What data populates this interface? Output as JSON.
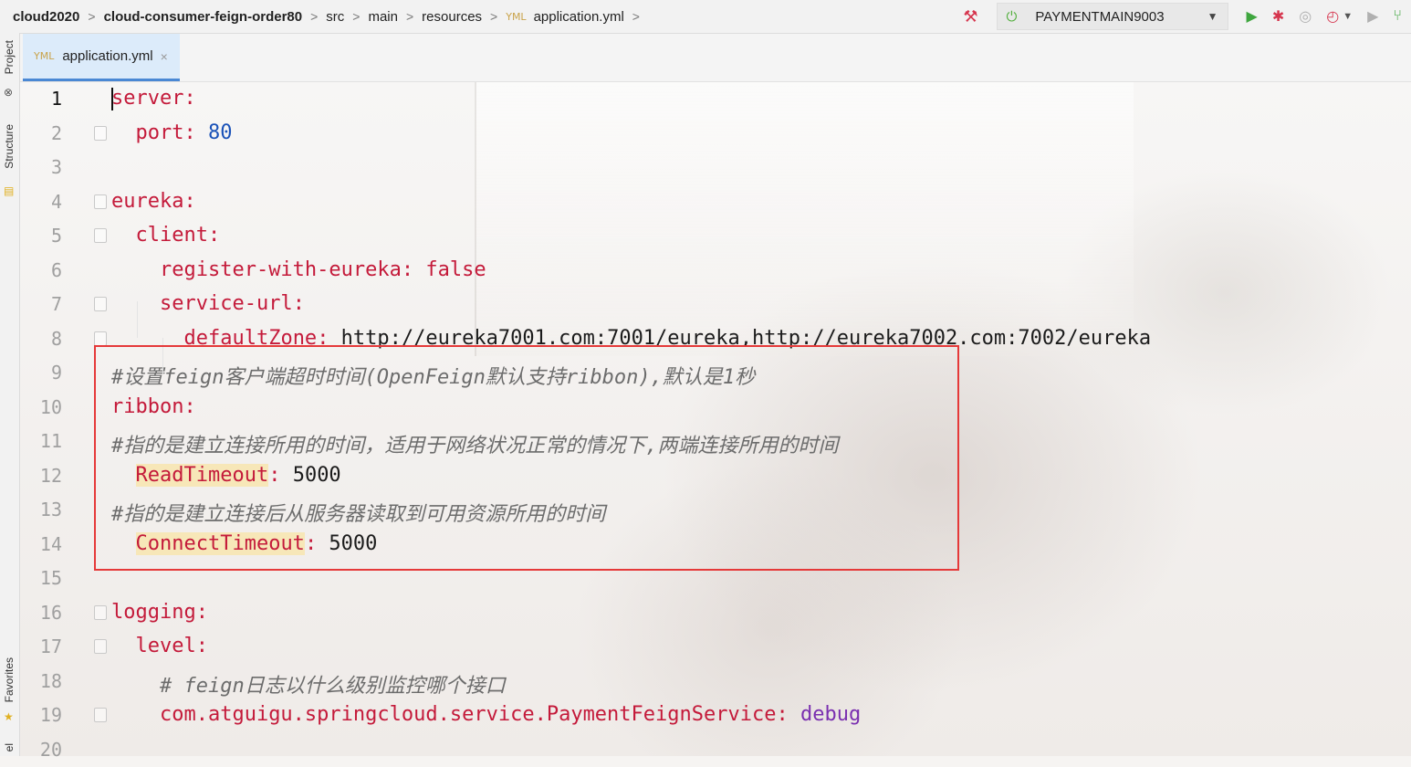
{
  "breadcrumbs": [
    "cloud2020",
    "cloud-consumer-feign-order80",
    "src",
    "main",
    "resources",
    "application.yml"
  ],
  "breadcrumb_file_icon": "YML",
  "run_config": "PAYMENTMAIN9003",
  "tab": {
    "label": "application.yml",
    "close": "×"
  },
  "left_strip": {
    "project": "Project",
    "structure": "Structure",
    "favorites": "Favorites",
    "bottom": "el"
  },
  "icons": {
    "build": "hammer-icon",
    "power": "power-icon",
    "dropdown": "chevron-down-icon",
    "run": "run-icon",
    "debug": "bug-icon",
    "coverage": "coverage-icon",
    "profiler": "profiler-icon",
    "stop": "stop-icon",
    "vcs": "git-branch-icon"
  },
  "colors": {
    "key": "#c41a3a",
    "number": "#1a52b8",
    "comment": "#6c6c6c",
    "enum": "#7a2fb0",
    "highlight": "#f7e7b8",
    "box": "#e53939",
    "tab_active": "#dcebfa"
  },
  "editor": {
    "current_line": 1,
    "lines": [
      {
        "n": "1",
        "kind": "kv",
        "indent": 0,
        "key": "server",
        "colon": ":",
        "value": "",
        "fold": false
      },
      {
        "n": "2",
        "kind": "kv",
        "indent": 1,
        "key": "port",
        "colon": ":",
        "value": " 80",
        "vclass": "num",
        "fold": true
      },
      {
        "n": "3",
        "kind": "blank",
        "fold": false
      },
      {
        "n": "4",
        "kind": "kv",
        "indent": 0,
        "key": "eureka",
        "colon": ":",
        "value": "",
        "fold": true
      },
      {
        "n": "5",
        "kind": "kv",
        "indent": 1,
        "key": "client",
        "colon": ":",
        "value": "",
        "fold": true
      },
      {
        "n": "6",
        "kind": "kv",
        "indent": 2,
        "key": "register-with-eureka",
        "colon": ":",
        "value": " false",
        "vclass": "kw",
        "fold": false
      },
      {
        "n": "7",
        "kind": "kv",
        "indent": 2,
        "key": "service-url",
        "colon": ":",
        "value": "",
        "fold": true
      },
      {
        "n": "8",
        "kind": "kv",
        "indent": 3,
        "key": "defaultZone",
        "colon": ":",
        "value": " http://eureka7001.com:7001/eureka,http://eureka7002.com:7002/eureka",
        "vclass": "v",
        "fold": true
      },
      {
        "n": "9",
        "kind": "comment",
        "indent": 0,
        "text": "#设置feign客户端超时时间(OpenFeign默认支持ribbon),默认是1秒",
        "fold": false
      },
      {
        "n": "10",
        "kind": "kv",
        "indent": 0,
        "key": "ribbon",
        "colon": ":",
        "value": "",
        "fold": false
      },
      {
        "n": "11",
        "kind": "comment",
        "indent": 0,
        "text": "#指的是建立连接所用的时间，适用于网络状况正常的情况下,两端连接所用的时间",
        "fold": false
      },
      {
        "n": "12",
        "kind": "kv",
        "indent": 1,
        "key": "ReadTimeout",
        "colon": ":",
        "value": " 5000",
        "vclass": "v",
        "hl": true,
        "fold": false
      },
      {
        "n": "13",
        "kind": "comment",
        "indent": 0,
        "text": "#指的是建立连接后从服务器读取到可用资源所用的时间",
        "fold": false
      },
      {
        "n": "14",
        "kind": "kv",
        "indent": 1,
        "key": "ConnectTimeout",
        "colon": ":",
        "value": " 5000",
        "vclass": "v",
        "hl": true,
        "fold": false
      },
      {
        "n": "15",
        "kind": "blank",
        "fold": false
      },
      {
        "n": "16",
        "kind": "kv",
        "indent": 0,
        "key": "logging",
        "colon": ":",
        "value": "",
        "fold": true
      },
      {
        "n": "17",
        "kind": "kv",
        "indent": 1,
        "key": "level",
        "colon": ":",
        "value": "",
        "fold": true
      },
      {
        "n": "18",
        "kind": "comment",
        "indent": 2,
        "text": "# feign日志以什么级别监控哪个接口",
        "fold": false
      },
      {
        "n": "19",
        "kind": "kv",
        "indent": 2,
        "key": "com.atguigu.springcloud.service.PaymentFeignService",
        "colon": ":",
        "value": " debug",
        "vclass": "purple",
        "fold": true
      },
      {
        "n": "20",
        "kind": "blank",
        "fold": false
      }
    ]
  }
}
